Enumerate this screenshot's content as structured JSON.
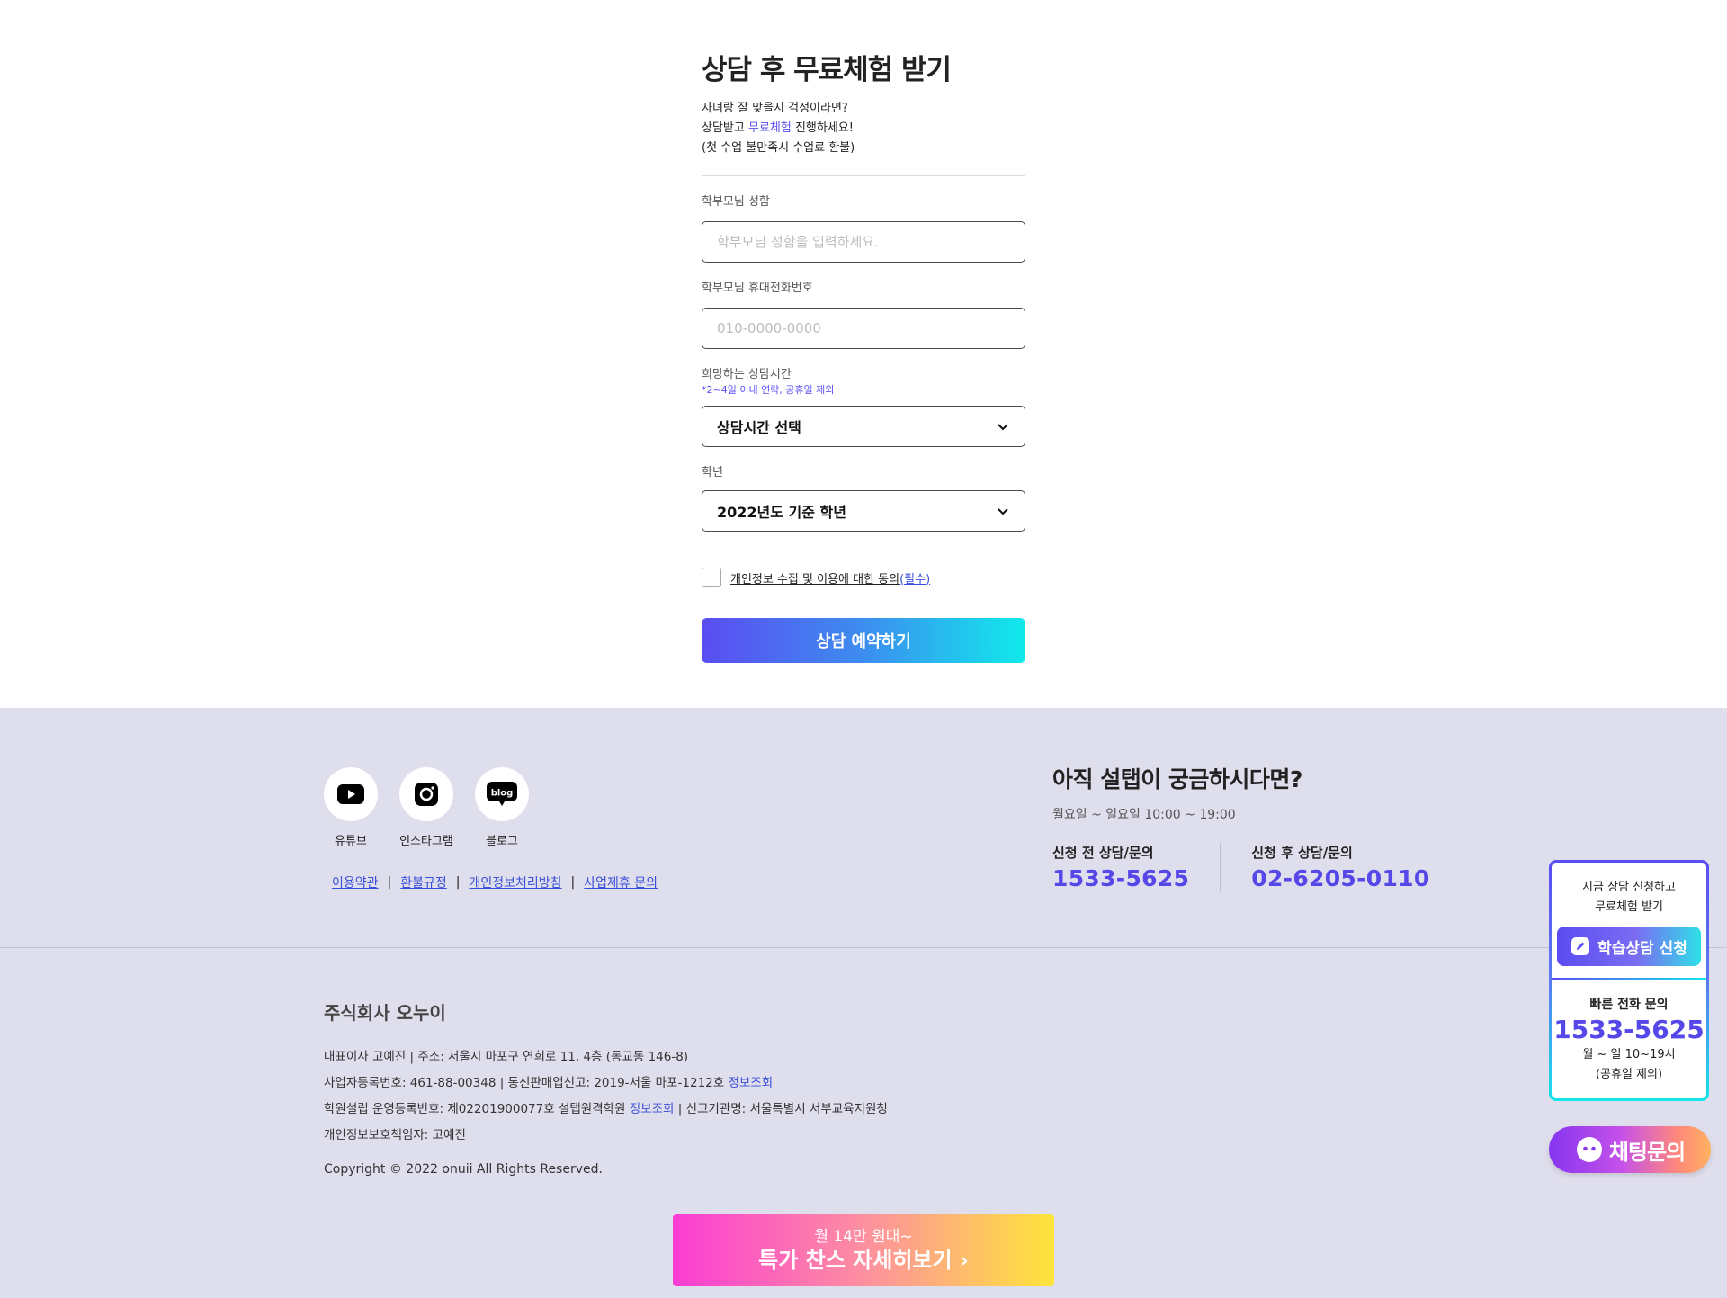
{
  "form": {
    "title": "상담 후 무료체험 받기",
    "intro_line1": "자녀랑 잘 맞을지 걱정이라면?",
    "intro_line2_prefix": "상담받고 ",
    "intro_line2_accent": "무료체험",
    "intro_line2_suffix": " 진행하세요!",
    "intro_line3": "(첫 수업 불만족시 수업료 환불)",
    "name_label": "학부모님 성함",
    "name_placeholder": "학부모님 성함을 입력하세요.",
    "name_value": "",
    "phone_label": "학부모님 휴대전화번호",
    "phone_placeholder": "010-0000-0000",
    "phone_value": "",
    "time_label": "희망하는 상담시간",
    "time_note": "*2~4일 이내 연락, 공휴일 제외",
    "time_selected": "상담시간 선택",
    "grade_label": "학년",
    "grade_selected": "2022년도 기준 학년",
    "agree_text": "개인정보 수집 및 이용에 대한 동의",
    "agree_required": "(필수)",
    "agree_checked": false,
    "submit_label": "상담 예약하기"
  },
  "footer": {
    "social": [
      {
        "label": "유튜브",
        "icon": "youtube-icon"
      },
      {
        "label": "인스타그램",
        "icon": "instagram-icon"
      },
      {
        "label": "블로그",
        "icon": "blog-icon",
        "icon_text": "blog"
      }
    ],
    "links": [
      "이용약관",
      "환불규정",
      "개인정보처리방침",
      "사업제휴 문의"
    ],
    "link_separator": "|",
    "help_title": "아직 설탭이 궁금하시다면?",
    "help_hours": "월요일 ~ 일요일 10:00 ~ 19:00",
    "phone_before_label": "신청 전 상담/문의",
    "phone_before": "1533-5625",
    "phone_after_label": "신청 후 상담/문의",
    "phone_after": "02-6205-0110",
    "company_name": "주식회사 오누이",
    "info_line1": "대표이사 고예진 | 주소: 서울시 마포구 연희로 11, 4층 (동교동 146-8)",
    "info_line2_prefix": "사업자등록번호: 461-88-00348 | 통신판매업신고: 2019-서울 마포-1212호 ",
    "info_line2_link": "정보조회",
    "info_line3_prefix": "학원설립 운영등록번호: 제02201900077호 설탭원격학원 ",
    "info_line3_link": "정보조회",
    "info_line3_suffix": " | 신고기관명: 서울특별시 서부교육지원청",
    "info_line4": "개인정보보호책임자: 고예진",
    "copyright": "Copyright © 2022 onuii All Rights Reserved.",
    "promo_sub": "월 14만 원대~",
    "promo_main": "특가 찬스 자세히보기 ›"
  },
  "widget": {
    "line1": "지금 상담 신청하고",
    "line2": "무료체험 받기",
    "button_label": "학습상담 신청",
    "phone_label": "빠른 전화 문의",
    "phone": "1533-5625",
    "hours": "월 ~ 일 10~19시",
    "note": "(공휴일 제외)"
  },
  "chat": {
    "label": "채팅문의"
  },
  "colors": {
    "accent": "#5647e8",
    "link": "#3b4fd8",
    "footer_bg": "#dfdeec"
  }
}
